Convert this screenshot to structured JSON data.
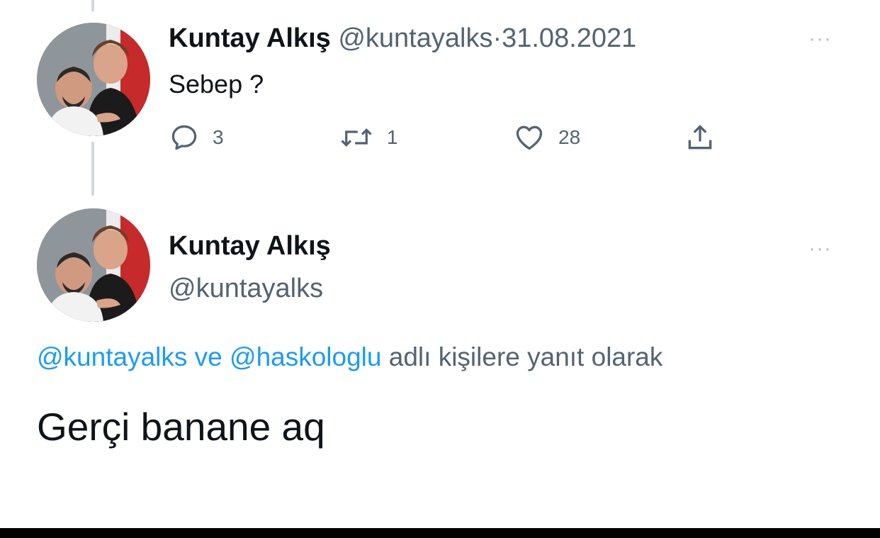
{
  "tweet1": {
    "display_name": "Kuntay Alkış",
    "handle": "@kuntayalks",
    "separator": "·",
    "date": "31.08.2021",
    "text": "Sebep ?",
    "more_label": "···",
    "actions": {
      "reply": {
        "icon": "reply-icon",
        "count": "3"
      },
      "retweet": {
        "icon": "retweet-icon",
        "count": "1"
      },
      "like": {
        "icon": "heart-icon",
        "count": "28"
      },
      "share": {
        "icon": "share-icon"
      }
    }
  },
  "tweet2": {
    "display_name": "Kuntay Alkış",
    "handle": "@kuntayalks",
    "more_label": "···",
    "reply_context": {
      "mention1": "@kuntayalks",
      "connector": " ve ",
      "mention2": "@haskologlu",
      "suffix": " adlı kişilere yanıt olarak"
    },
    "text": "Gerçi banane aq"
  },
  "colors": {
    "accent": "#1d9bf0",
    "text": "#0f1419",
    "secondary": "#536471",
    "thread_line": "#cfd9de"
  }
}
